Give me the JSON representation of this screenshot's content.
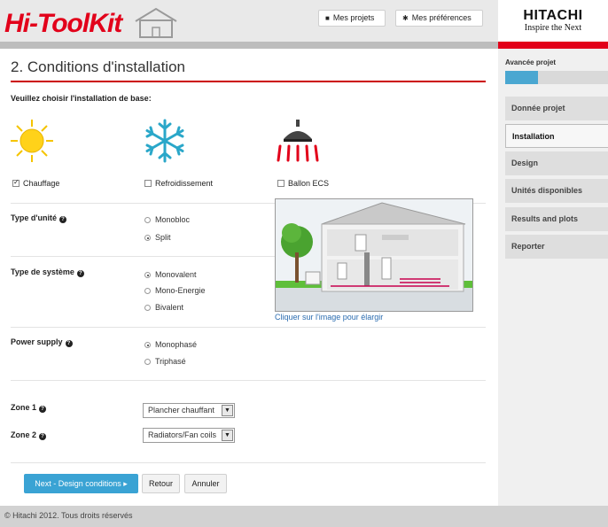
{
  "header": {
    "logo": "Hi-ToolKit",
    "buttons": [
      {
        "label": "Mes projets",
        "icon": "folder-icon"
      },
      {
        "label": "Mes préférences",
        "icon": "gear-icon"
      }
    ]
  },
  "brand": {
    "name": "HITACHI",
    "tagline": "Inspire the Next"
  },
  "sidebar": {
    "progress_label": "Avancée projet",
    "progress_fraction": 0.32,
    "items": [
      "Donnée projet",
      "Installation",
      "Design",
      "Unités disponibles",
      "Results and plots",
      "Reporter"
    ],
    "active_index": 1
  },
  "main": {
    "title": "2. Conditions d'installation",
    "instruction": "Veuillez choisir l'installation de base:",
    "applications": [
      {
        "label": "Chauffage",
        "checked": true,
        "icon": "sun-icon"
      },
      {
        "label": "Refroidissement",
        "checked": false,
        "icon": "snowflake-icon"
      },
      {
        "label": "Ballon ECS",
        "checked": false,
        "icon": "shower-icon"
      }
    ],
    "unit_type": {
      "label": "Type d'unité",
      "options": [
        "Monobloc",
        "Split"
      ],
      "selected": 1
    },
    "system_type": {
      "label": "Type de système",
      "options": [
        "Monovalent",
        "Mono-Energie",
        "Bivalent"
      ],
      "selected": 0
    },
    "power_supply": {
      "label": "Power supply",
      "options": [
        "Monophasé",
        "Triphasé"
      ],
      "selected": 0
    },
    "image_link": "Cliquer sur l'image pour élargir",
    "zone1": {
      "label": "Zone 1",
      "value": "Plancher chauffant"
    },
    "zone2": {
      "label": "Zone 2",
      "value": "Radiators/Fan coils"
    },
    "buttons": {
      "next": "Next - Design conditions ▸",
      "back": "Retour",
      "cancel": "Annuler"
    }
  },
  "footer": {
    "copyright": "© Hitachi 2012. Tous droits réservés"
  },
  "colors": {
    "brand_red": "#e2001a",
    "accent_blue": "#3aa3d4",
    "sidebar_bg": "#f0f0f0"
  }
}
